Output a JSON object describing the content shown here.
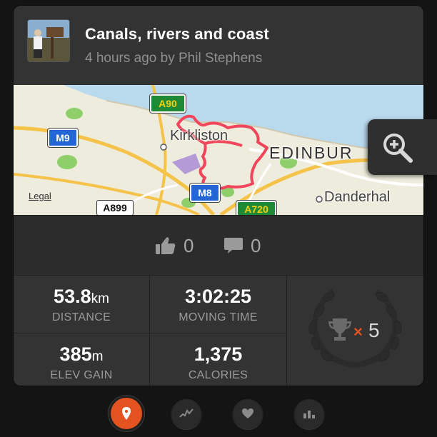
{
  "activity": {
    "title": "Canals, rivers and coast",
    "subtitle": "4 hours ago by Phil Stephens"
  },
  "map": {
    "labels": {
      "a90": "A90",
      "m9": "M9",
      "kirkliston": "Kirkliston",
      "edinburgh": "EDINBUR",
      "legal": "Legal",
      "a899": "A899",
      "m8": "M8",
      "a720": "A720",
      "danderhall": "Danderhal"
    },
    "colors": {
      "water": "#b9d9ec",
      "land": "#eeecdc",
      "route": "#f0455a",
      "road": "#f5c24a",
      "green": "#8fcf6a"
    }
  },
  "social": {
    "kudos_count": "0",
    "comment_count": "0"
  },
  "stats": {
    "distance": {
      "value": "53.8",
      "unit": "km",
      "label": "DISTANCE"
    },
    "moving_time": {
      "value": "3:02:25",
      "label": "MOVING TIME"
    },
    "elev_gain": {
      "value": "385",
      "unit": "m",
      "label": "ELEV GAIN"
    },
    "calories": {
      "value": "1,375",
      "label": "CALORIES"
    }
  },
  "achievements": {
    "multiplier": "×",
    "count": "5",
    "accent": "#e4531f"
  },
  "tabbar": {
    "icons": [
      "map-pin-icon",
      "analysis-icon",
      "heart-icon",
      "segments-icon"
    ],
    "active_color": "#e4531f"
  }
}
